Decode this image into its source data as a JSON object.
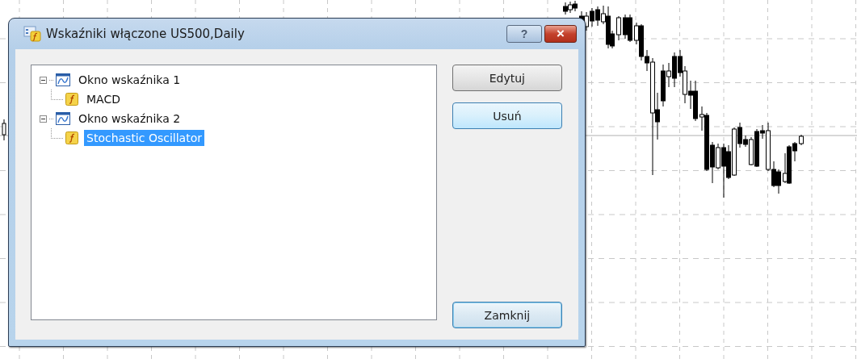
{
  "dialog": {
    "title": "Wskaźniki włączone US500,Daily",
    "title_buttons": [
      {
        "kind": "help",
        "label": "?"
      },
      {
        "kind": "close",
        "label": "×"
      }
    ],
    "tree": [
      {
        "kind": "window",
        "label": "Okno wskaźnika 1",
        "expanded": true,
        "selected": false,
        "children": [
          {
            "kind": "indicator",
            "label": "MACD",
            "selected": false
          }
        ]
      },
      {
        "kind": "window",
        "label": "Okno wskaźnika 2",
        "expanded": true,
        "selected": false,
        "children": [
          {
            "kind": "indicator",
            "label": "Stochastic Oscillator",
            "selected": true
          }
        ]
      }
    ],
    "buttons": [
      {
        "label": "Edytuj",
        "kind": "normal"
      },
      {
        "label": "Usuń",
        "kind": "hot"
      },
      {
        "label": "Zamknij",
        "kind": "default"
      }
    ]
  }
}
